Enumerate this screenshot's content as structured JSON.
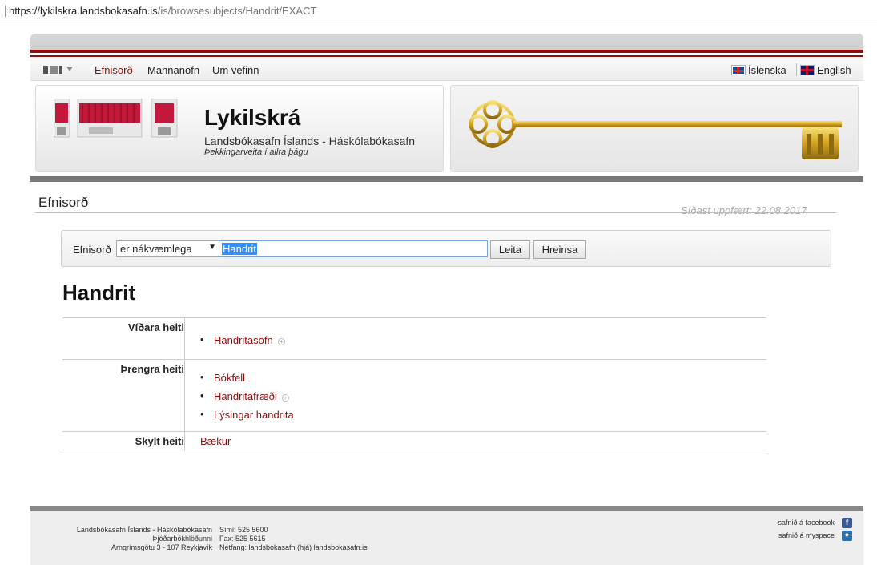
{
  "browser": {
    "url_host": "https://lykilskra.landsbokasafn.is",
    "url_path": "/is/browsesubjects/Handrit/EXACT"
  },
  "topmenu": {
    "items": [
      "Efnisorð",
      "Mannanöfn",
      "Um vefinn"
    ],
    "lang_is": "Íslenska",
    "lang_en": "English"
  },
  "header": {
    "title": "Lykilskrá",
    "subtitle": "Landsbókasafn Íslands - Háskólabókasafn",
    "tagline": "Þekkingarveita í allra þágu"
  },
  "page": {
    "heading": "Efnisorð",
    "updated": "Síðast uppfært: 22.08.2017"
  },
  "search": {
    "label": "Efnisorð",
    "match_select": "er nákvæmlega",
    "query": "Handrit",
    "search_button": "Leita",
    "clear_button": "Hreinsa"
  },
  "subject": {
    "title": "Handrit",
    "broader_label": "Víðara heiti",
    "broader": [
      {
        "label": "Handritasöfn",
        "expandable": true
      }
    ],
    "narrower_label": "Þrengra heiti",
    "narrower": [
      {
        "label": "Bókfell",
        "expandable": false
      },
      {
        "label": "Handritafræði",
        "expandable": true
      },
      {
        "label": "Lýsingar handrita",
        "expandable": false
      }
    ],
    "related_label": "Skylt heiti",
    "related": "Bækur"
  },
  "footer": {
    "org": "Landsbókasafn Íslands - Háskólabókasafn",
    "org2": "Þjóðarbókhlöðunni",
    "address": "Arngrímsgötu 3 - 107 Reykjavík",
    "phone": "Sími: 525 5600",
    "fax": "Fax: 525 5615",
    "email": "Netfang: landsbokasafn (hjá) landsbokasafn.is",
    "facebook": "safnið á facebook",
    "myspace": "safnið á myspace"
  },
  "colors": {
    "brand_red": "#8c0e0e",
    "link": "#8c0e0e"
  }
}
